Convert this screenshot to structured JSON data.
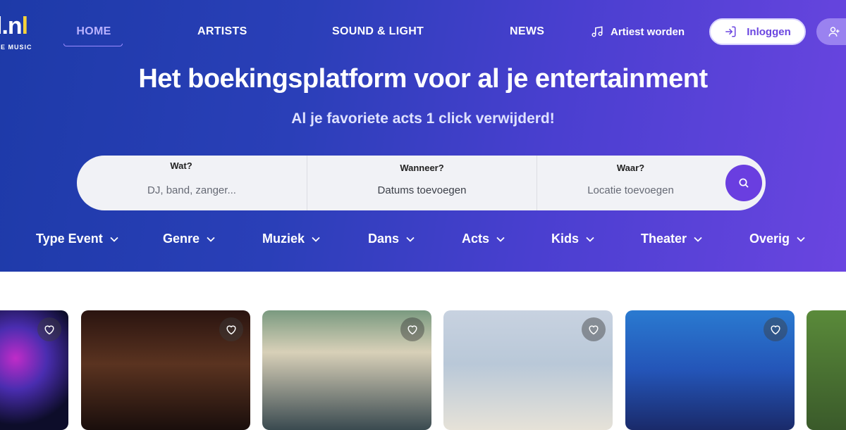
{
  "logo": {
    "mark_white": "l.n",
    "mark_yellow": "l",
    "subtitle": "VE MUSIC"
  },
  "nav": {
    "home": "HOME",
    "artists": "ARTISTS",
    "sound_light": "SOUND & LIGHT",
    "news": "NEWS",
    "artiest_worden": "Artiest worden",
    "inloggen": "Inloggen"
  },
  "hero": {
    "title": "Het boekingsplatform voor al je entertainment",
    "subtitle": "Al je favoriete acts 1 click verwijderd!"
  },
  "search": {
    "what_label": "Wat?",
    "what_placeholder": "DJ, band, zanger...",
    "when_label": "Wanneer?",
    "when_value": "Datums toevoegen",
    "where_label": "Waar?",
    "where_placeholder": "Locatie toevoegen"
  },
  "categories": [
    "Type Event",
    "Genre",
    "Muziek",
    "Dans",
    "Acts",
    "Kids",
    "Theater",
    "Overig"
  ],
  "colors": {
    "hero_start": "#1d3aa8",
    "hero_end": "#6a45e0",
    "accent": "#6a3ee0",
    "logo_yellow": "#f6d23a"
  },
  "icons": {
    "music": "music-note-icon",
    "login": "login-arrow-icon",
    "user": "user-icon",
    "search": "search-icon",
    "chevron": "chevron-down-icon",
    "favorite": "heart-icon"
  }
}
